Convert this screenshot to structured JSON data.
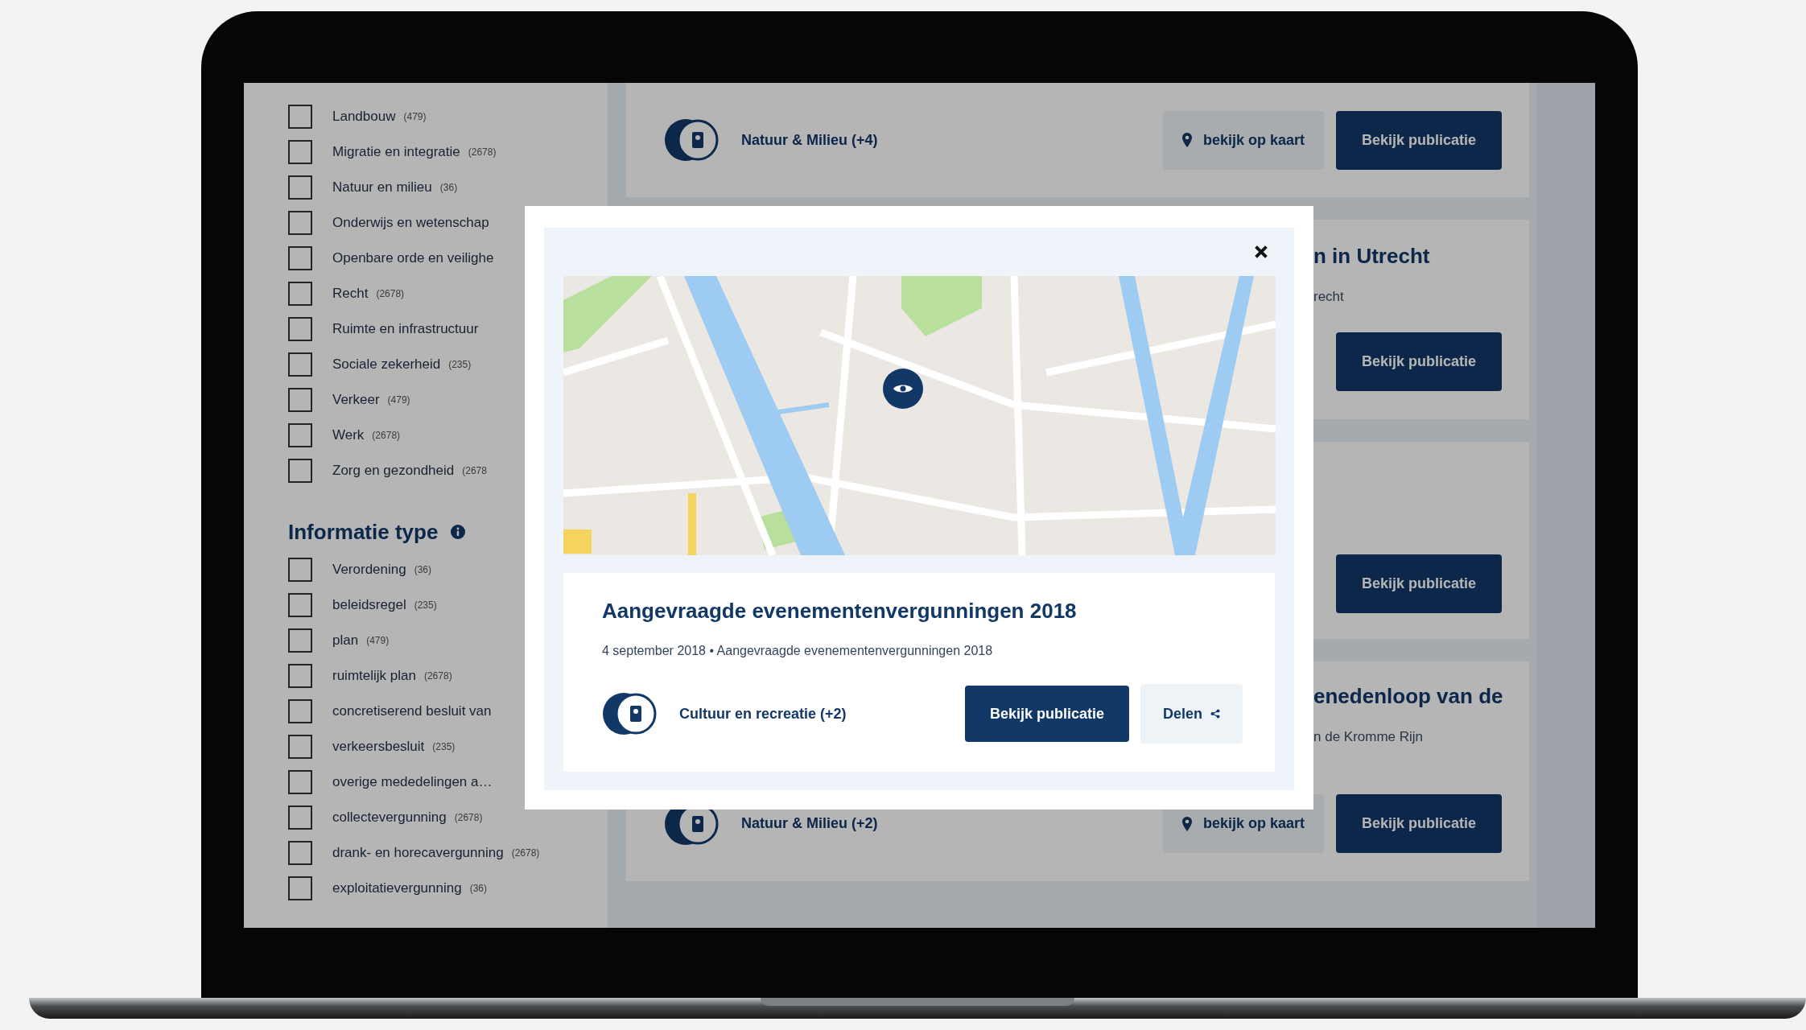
{
  "sidebar": {
    "sections": [
      {
        "items": [
          {
            "label": "Landbouw",
            "count": "(479)",
            "checked": false
          },
          {
            "label": "Migratie en integratie",
            "count": "(2678)",
            "checked": false
          },
          {
            "label": "Natuur en milieu",
            "count": "(36)",
            "checked": false
          },
          {
            "label": "Onderwijs en wetenschap",
            "checked": false
          },
          {
            "label": "Openbare orde en veilighe",
            "checked": false
          },
          {
            "label": "Recht",
            "count": "(2678)",
            "checked": false
          },
          {
            "label": "Ruimte en infrastructuur",
            "checked": false
          },
          {
            "label": "Sociale zekerheid",
            "count": "(235)",
            "checked": false
          },
          {
            "label": "Verkeer",
            "count": "(479)",
            "checked": false
          },
          {
            "label": "Werk",
            "count": "(2678)",
            "checked": false
          },
          {
            "label": "Zorg en gezondheid",
            "count": "(2678",
            "checked": false
          }
        ]
      },
      {
        "title": "Informatie type",
        "items": [
          {
            "label": "Verordening",
            "count": "(36)",
            "checked": false
          },
          {
            "label": "beleidsregel",
            "count": "(235)",
            "checked": false
          },
          {
            "label": "plan",
            "count": "(479)",
            "checked": false
          },
          {
            "label": "ruimtelijk plan",
            "count": "(2678)",
            "checked": false
          },
          {
            "label": "concretiserend besluit van",
            "checked": false
          },
          {
            "label": "verkeersbesluit",
            "count": "(235)",
            "checked": false
          },
          {
            "label": "overige mededelingen a…",
            "checked": false
          },
          {
            "label": "collectevergunning",
            "count": "(2678)",
            "checked": false
          },
          {
            "label": "drank- en horecavergunning",
            "count": "(2678)",
            "checked": false
          },
          {
            "label": "exploitatievergunning",
            "count": "(36)",
            "checked": false
          }
        ]
      }
    ]
  },
  "results": [
    {
      "category": "Natuur & Milieu (+4)",
      "map_button": "bekijk op kaart",
      "button": "Bekijk publicatie"
    },
    {
      "title": "n in Utrecht",
      "subtitle": "recht",
      "button": "Bekijk publicatie"
    },
    {
      "button": "Bekijk publicatie"
    },
    {
      "title": "enedenloop van de",
      "subtitle": "n de Kromme Rijn",
      "category": "Natuur & Milieu (+2)",
      "map_button": "bekijk op kaart",
      "button": "Bekijk publicatie"
    }
  ],
  "modal": {
    "title": "Aangevraagde evenementenvergunningen 2018",
    "meta": "4 september 2018 • Aangevraagde evenementenvergunningen 2018",
    "category": "Cultuur en recreatie (+2)",
    "primary_button": "Bekijk publicatie",
    "share_button": "Delen"
  }
}
